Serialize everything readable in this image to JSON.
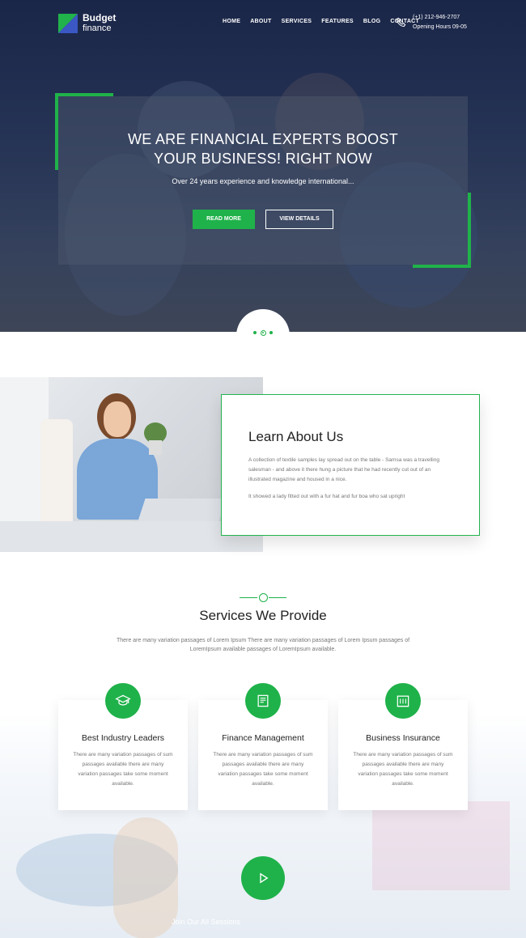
{
  "brand": {
    "name_line1": "Budget",
    "name_line2": "finance"
  },
  "nav": {
    "items": [
      "HOME",
      "ABOUT",
      "SERVICES",
      "FEATURES",
      "BLOG",
      "CONTACT"
    ]
  },
  "contact": {
    "phone": "(+1) 212-946-2707",
    "hours": "Opening Hours 09-05"
  },
  "hero": {
    "title_line1": "WE ARE FINANCIAL EXPERTS BOOST",
    "title_line2": "YOUR BUSINESS! RIGHT NOW",
    "subtitle": "Over 24 years experience and knowledge international...",
    "btn_primary": "READ MORE",
    "btn_secondary": "VIEW DETAILS"
  },
  "about": {
    "title": "Learn About Us",
    "p1": "A collection of textile samples lay spread out on the table - Samsa was a travelling salesman - and above it there hung a picture that he had recently cut out of an illustrated magazine and housed in a nice.",
    "p2": "It showed a lady fitted out with a fur hat and fur boa who sat upright"
  },
  "services": {
    "title": "Services We Provide",
    "intro": "There are many variation passages of Lorem Ipsum There are many variation passages of Lorem Ipsum passages of LoremIpsum available passages of LoremIpsum available.",
    "items": [
      {
        "title": "Best Industry Leaders",
        "text": "There are many variation passages of sum passages available there are many variation passages take some moment available.",
        "icon": "graduation-cap-icon"
      },
      {
        "title": "Finance Management",
        "text": "There are many variation passages of sum passages available there are many variation passages take some moment available.",
        "icon": "document-stack-icon"
      },
      {
        "title": "Business Insurance",
        "text": "There are many variation passages of sum passages available there are many variation passages take some moment available.",
        "icon": "building-icon"
      }
    ]
  },
  "video": {
    "caption": "Join Our All Sessions"
  },
  "colors": {
    "accent": "#1fb24a",
    "brand_blue": "#3a57c4",
    "hero_bg": "#2b3a5e"
  }
}
